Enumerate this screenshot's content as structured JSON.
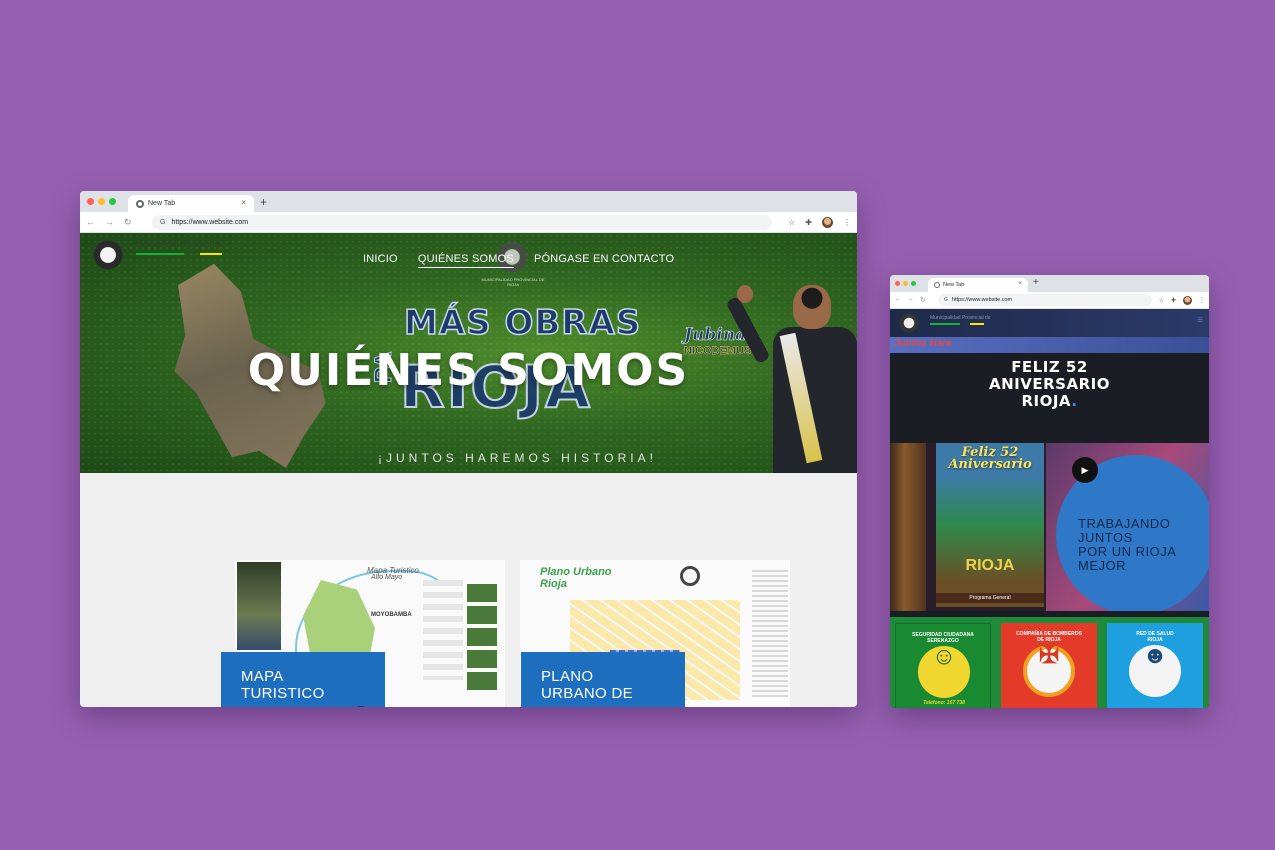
{
  "desktop_browser": {
    "tab_title": "New Tab",
    "new_tab_symbol": "+",
    "close_symbol": "×",
    "url": "https://www.website.com",
    "nav_icons": [
      "back-arrow-icon",
      "forward-arrow-icon",
      "reload-icon"
    ],
    "right_icons": [
      "star-icon",
      "extensions-icon",
      "avatar",
      "menu-dots-icon"
    ],
    "site": {
      "municipality_label": "Municipalidad Provincial de",
      "nav": [
        "INICIO",
        "QUIÉNES SOMOS",
        "PÓNGASE EN CONTACTO"
      ],
      "active_nav": "QUIÉNES SOMOS",
      "seal_text": "MUNICIPALIDAD PROVINCIAL DE RIOJA",
      "hero": {
        "banner_headline": "MÁS OBRAS",
        "banner_pa": "PA",
        "banner_rioja": "RIOJA",
        "jubinal": "Jubinal",
        "nicodemus": "NICODEMUS",
        "title": "QUIÉNES SOMOS",
        "slogan": "¡JUNTOS HAREMOS HISTORIA!"
      },
      "cards": [
        {
          "map_title": "Mapa Turistico",
          "map_subtitle": "Alto Mayo",
          "map_place": "MOYOBAMBA",
          "label_line1": "MAPA",
          "label_line2": "TURISTICO"
        },
        {
          "map_title": "Plano Urbano",
          "map_subtitle": "Rioja",
          "label_line1": "PLANO",
          "label_line2": "URBANO DE"
        }
      ]
    }
  },
  "mobile_browser": {
    "tab_title": "New Tab",
    "new_tab_symbol": "+",
    "close_symbol": "×",
    "url": "https://www.website.com",
    "site": {
      "municipality_label": "Municipalidad Provincial de",
      "menu_icon": "hamburger-icon",
      "strip_text": "Juntos Hare",
      "feliz_line1": "FELIZ 52",
      "feliz_line2": "ANIVERSARIO",
      "feliz_line3": "RIOJA",
      "feliz_dot": ".",
      "poster_title": "Feliz 52 Aniversario",
      "poster_rioja": "RIOJA",
      "poster_footer": "Programa General",
      "circle_text": [
        "TRABAJANDO",
        "JUNTOS",
        "POR UN RIOJA",
        "MEJOR"
      ],
      "play_symbol": "▶",
      "services": [
        {
          "title_line1": "SEGURIDAD CIUDADANA",
          "title_line2": "SERENAZGO",
          "phone": "Teléfono: 167 738",
          "icon": "officer-icon"
        },
        {
          "title_line1": "COMPAÑIA DE BOMBEROS",
          "title_line2": "DE RIOJA",
          "phone": "",
          "icon": "firefighter-emblem-icon"
        },
        {
          "title_line1": "RED DE SALUD",
          "title_line2": "RIOJA",
          "phone": "",
          "icon": "health-person-icon"
        }
      ]
    }
  },
  "colors": {
    "background": "#9560b0",
    "hero_green": "#2f6620",
    "accent_blue": "#1e6ec0",
    "bar_green": "#18b03c",
    "bar_yellow": "#ffe600"
  }
}
